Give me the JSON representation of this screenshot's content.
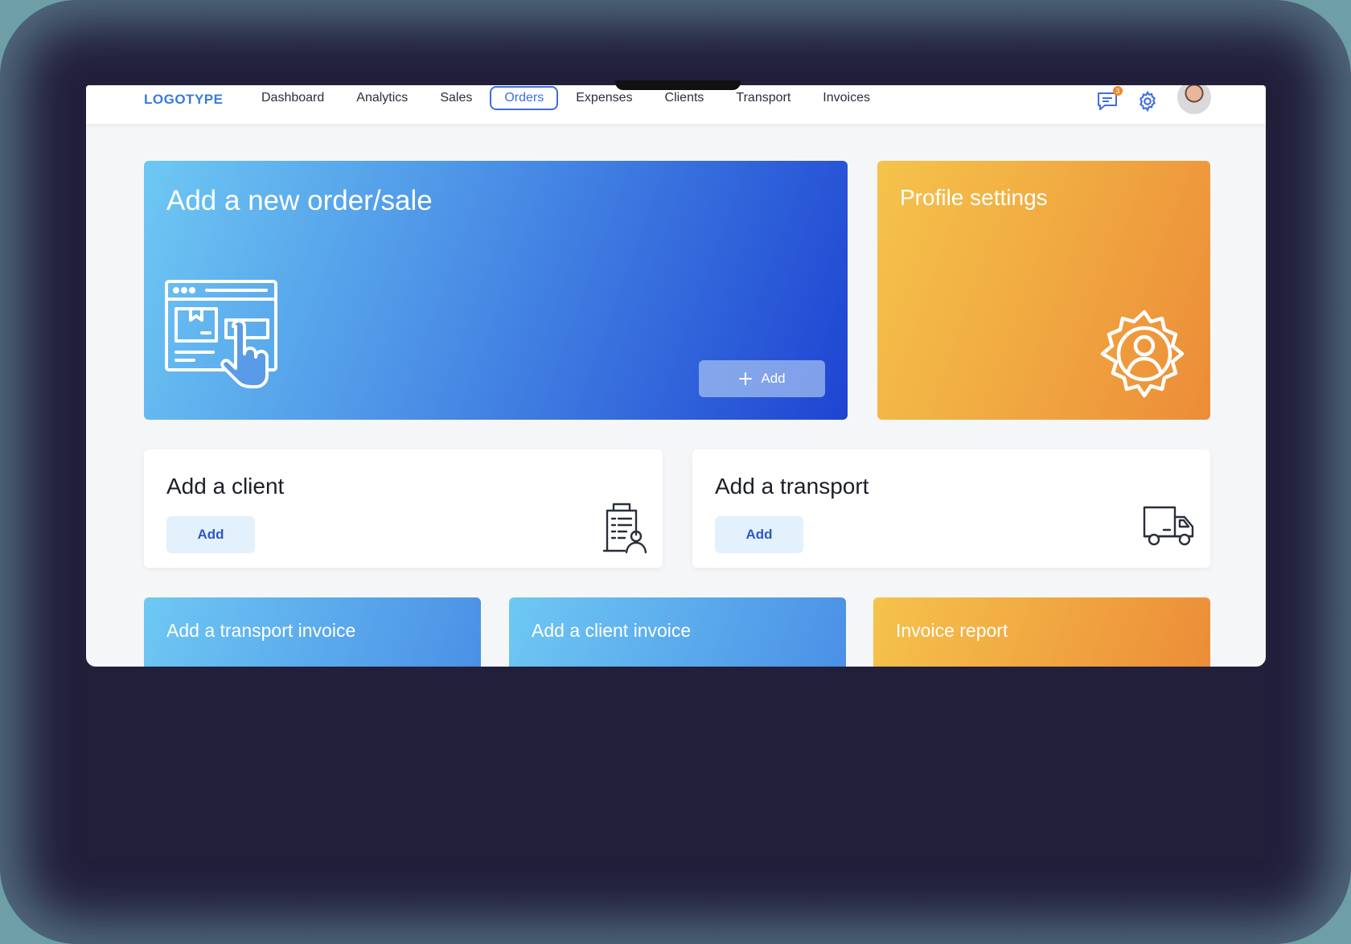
{
  "header": {
    "logo": "LOGOTYPE",
    "nav": [
      "Dashboard",
      "Analytics",
      "Sales",
      "Orders",
      "Expenses",
      "Clients",
      "Transport",
      "Invoices"
    ],
    "active_nav": "Orders",
    "notification_count": "3"
  },
  "cards": {
    "order": {
      "title": "Add a new order/sale",
      "button": "Add"
    },
    "profile": {
      "title": "Profile settings"
    },
    "client": {
      "title": "Add a client",
      "button": "Add"
    },
    "transport": {
      "title": "Add a transport",
      "button": "Add"
    },
    "transport_invoice": {
      "title": "Add a transport invoice"
    },
    "client_invoice": {
      "title": "Add a client invoice"
    },
    "invoice_report": {
      "title": "Invoice report"
    }
  },
  "colors": {
    "accent": "#3f6ce0",
    "blue_gradient_start": "#6ec8f3",
    "blue_gradient_end": "#1e44d2",
    "orange_gradient_start": "#f5c34b",
    "orange_gradient_end": "#ec8c38",
    "badge": "#f08a2b"
  },
  "icons": {
    "chat": "chat-icon",
    "settings": "gear-icon",
    "order": "online-order-icon",
    "profile": "profile-gear-icon",
    "client": "client-building-icon",
    "transport": "truck-icon"
  }
}
